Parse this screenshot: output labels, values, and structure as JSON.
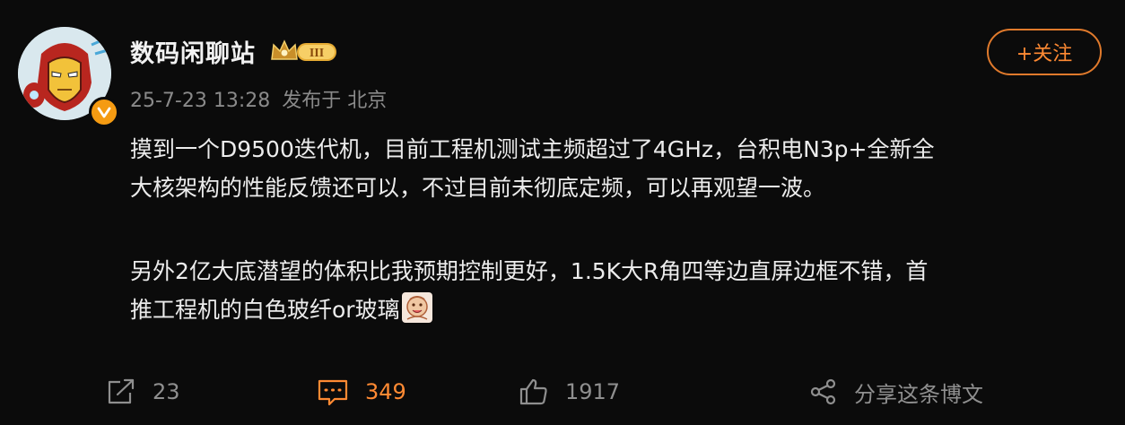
{
  "post": {
    "author": {
      "name": "数码闲聊站",
      "level_badge": "III",
      "verified": true
    },
    "timestamp": "25-7-23 13:28",
    "published_from": "发布于 北京",
    "follow_label": "+关注",
    "body_lines": [
      "摸到一个D9500迭代机，目前工程机测试主频超过了4GHz，台积电N3p+全新全",
      "大核架构的性能反馈还可以，不过目前未彻底定频，可以再观望一波。",
      "另外2亿大底潜望的体积比我预期控制更好，1.5K大R角四等边直屏边框不错，首",
      "推工程机的白色玻纤or玻璃"
    ],
    "actions": {
      "repost": "23",
      "comments": "349",
      "likes": "1917",
      "share": "分享这条博文"
    }
  },
  "colors": {
    "accent": "#ff8a33",
    "background": "#0b0b0b",
    "muted_text": "#8a8a8a",
    "verified_badge": "#f59b12"
  },
  "icons": {
    "repost": "repost-icon",
    "comment": "comment-icon",
    "like": "thumbs-up-icon",
    "share": "share-icon",
    "emoji": "emoji-icon"
  }
}
